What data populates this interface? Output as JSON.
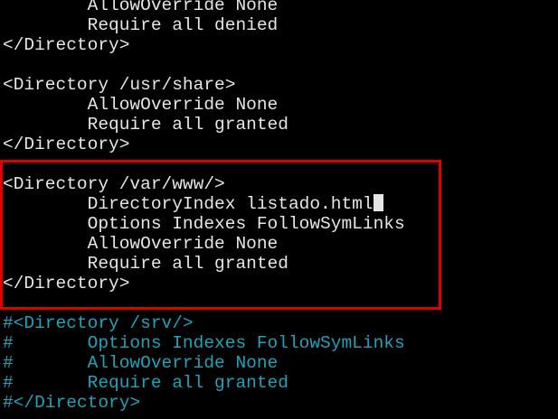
{
  "terminal": {
    "lines": [
      {
        "text": "        AllowOverride None",
        "style": "normal"
      },
      {
        "text": "        Require all denied",
        "style": "normal"
      },
      {
        "text": "</Directory>",
        "style": "normal"
      },
      {
        "text": "",
        "style": "normal"
      },
      {
        "text": "<Directory /usr/share>",
        "style": "normal"
      },
      {
        "text": "        AllowOverride None",
        "style": "normal"
      },
      {
        "text": "        Require all granted",
        "style": "normal"
      },
      {
        "text": "</Directory>",
        "style": "normal"
      },
      {
        "text": "",
        "style": "normal"
      },
      {
        "text": "<Directory /var/www/>",
        "style": "normal"
      },
      {
        "text": "        DirectoryIndex listado.html",
        "style": "normal",
        "cursor": true
      },
      {
        "text": "        Options Indexes FollowSymLinks",
        "style": "normal"
      },
      {
        "text": "        AllowOverride None",
        "style": "normal"
      },
      {
        "text": "        Require all granted",
        "style": "normal"
      },
      {
        "text": "</Directory>",
        "style": "normal"
      },
      {
        "text": "",
        "style": "normal"
      },
      {
        "text": "#<Directory /srv/>",
        "style": "comment"
      },
      {
        "text": "#       Options Indexes FollowSymLinks",
        "style": "comment"
      },
      {
        "text": "#       AllowOverride None",
        "style": "comment"
      },
      {
        "text": "#       Require all granted",
        "style": "comment"
      },
      {
        "text": "#</Directory>",
        "style": "comment"
      }
    ]
  },
  "colors": {
    "background": "#000000",
    "text": "#e6e6e6",
    "comment": "#1fa3b8",
    "highlight_border": "#e00000"
  }
}
